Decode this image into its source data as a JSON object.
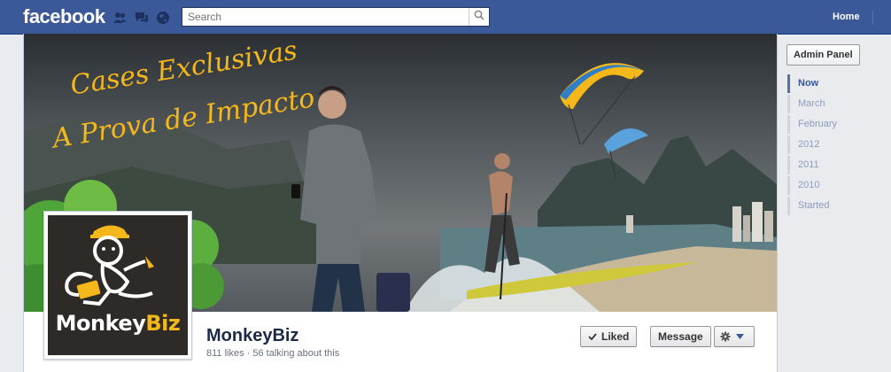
{
  "topbar": {
    "logo": "facebook",
    "search_placeholder": "Search",
    "home_label": "Home",
    "icons": [
      "friend-requests-icon",
      "messages-icon",
      "notifications-globe-icon",
      "search-icon"
    ]
  },
  "cover": {
    "headline_line1": "Cases Exclusivas",
    "headline_line2": "A Prova de Impacto",
    "accent_color": "#f5b81b"
  },
  "profile": {
    "logo_text_monkey": "Monkey",
    "logo_text_biz": "Biz",
    "page_name": "MonkeyBiz",
    "stats": "811 likes · 56 talking about this"
  },
  "actions": {
    "liked_label": "Liked",
    "message_label": "Message",
    "settings_icon": "gear-icon"
  },
  "sidebar": {
    "admin_panel_label": "Admin Panel",
    "timeline": [
      {
        "label": "Now",
        "active": true
      },
      {
        "label": "March",
        "active": false
      },
      {
        "label": "February",
        "active": false
      },
      {
        "label": "2012",
        "active": false
      },
      {
        "label": "2011",
        "active": false
      },
      {
        "label": "2010",
        "active": false
      },
      {
        "label": "Started",
        "active": false
      }
    ]
  },
  "colors": {
    "brand_blue": "#3b5998",
    "page_bg": "#e9ebee",
    "logo_yellow": "#f5b81b"
  }
}
